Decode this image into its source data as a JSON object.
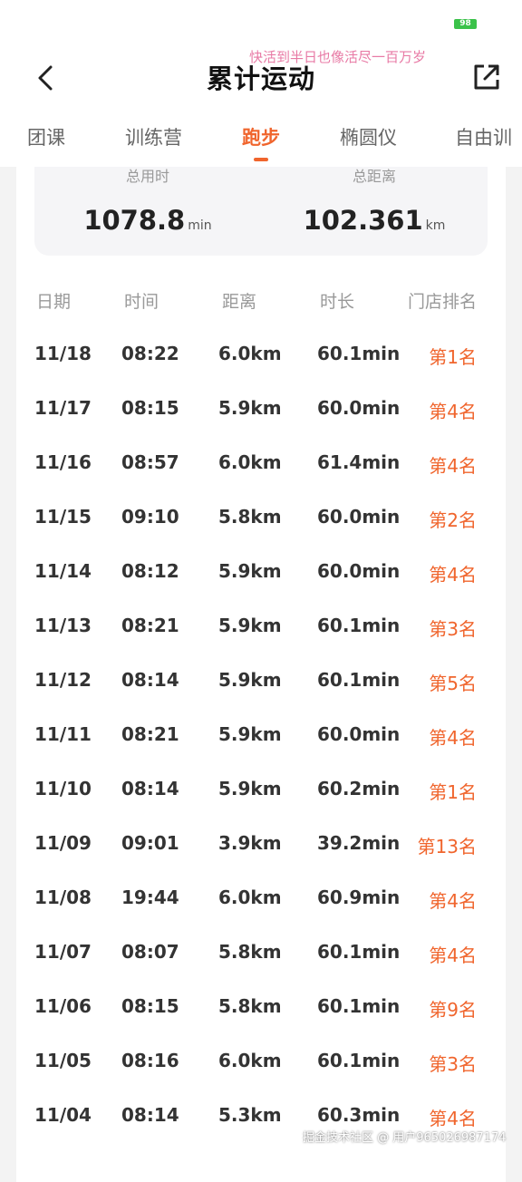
{
  "status": {
    "battery": "98"
  },
  "header": {
    "title": "累计运动",
    "overlay_text": "快活到半日也像活尽一百万岁"
  },
  "tabs": [
    {
      "label": "团课"
    },
    {
      "label": "训练营"
    },
    {
      "label": "跑步"
    },
    {
      "label": "椭圆仪"
    },
    {
      "label": "自由训"
    }
  ],
  "active_tab": 2,
  "summary": {
    "time_label": "总用时",
    "time_value": "1078.8",
    "time_unit": "min",
    "distance_label": "总距离",
    "distance_value": "102.361",
    "distance_unit": "km"
  },
  "table": {
    "headers": [
      "日期",
      "时间",
      "距离",
      "时长",
      "门店排名"
    ],
    "rows": [
      {
        "date": "11/18",
        "time": "08:22",
        "distance": "6.0km",
        "duration": "60.1min",
        "rank": "第1名"
      },
      {
        "date": "11/17",
        "time": "08:15",
        "distance": "5.9km",
        "duration": "60.0min",
        "rank": "第4名"
      },
      {
        "date": "11/16",
        "time": "08:57",
        "distance": "6.0km",
        "duration": "61.4min",
        "rank": "第4名"
      },
      {
        "date": "11/15",
        "time": "09:10",
        "distance": "5.8km",
        "duration": "60.0min",
        "rank": "第2名"
      },
      {
        "date": "11/14",
        "time": "08:12",
        "distance": "5.9km",
        "duration": "60.0min",
        "rank": "第4名"
      },
      {
        "date": "11/13",
        "time": "08:21",
        "distance": "5.9km",
        "duration": "60.1min",
        "rank": "第3名"
      },
      {
        "date": "11/12",
        "time": "08:14",
        "distance": "5.9km",
        "duration": "60.1min",
        "rank": "第5名"
      },
      {
        "date": "11/11",
        "time": "08:21",
        "distance": "5.9km",
        "duration": "60.0min",
        "rank": "第4名"
      },
      {
        "date": "11/10",
        "time": "08:14",
        "distance": "5.9km",
        "duration": "60.2min",
        "rank": "第1名"
      },
      {
        "date": "11/09",
        "time": "09:01",
        "distance": "3.9km",
        "duration": "39.2min",
        "rank": "第13名"
      },
      {
        "date": "11/08",
        "time": "19:44",
        "distance": "6.0km",
        "duration": "60.9min",
        "rank": "第4名"
      },
      {
        "date": "11/07",
        "time": "08:07",
        "distance": "5.8km",
        "duration": "60.1min",
        "rank": "第4名"
      },
      {
        "date": "11/06",
        "time": "08:15",
        "distance": "5.8km",
        "duration": "60.1min",
        "rank": "第9名"
      },
      {
        "date": "11/05",
        "time": "08:16",
        "distance": "6.0km",
        "duration": "60.1min",
        "rank": "第3名"
      },
      {
        "date": "11/04",
        "time": "08:14",
        "distance": "5.3km",
        "duration": "60.3min",
        "rank": "第4名"
      }
    ]
  },
  "footer_watermark": "掘金技术社区 @ 用户965026987174",
  "colors": {
    "accent": "#f0652d",
    "battery": "#3bc24a"
  },
  "icons": {
    "back": "chevron-left-icon",
    "share": "share-external-icon"
  }
}
